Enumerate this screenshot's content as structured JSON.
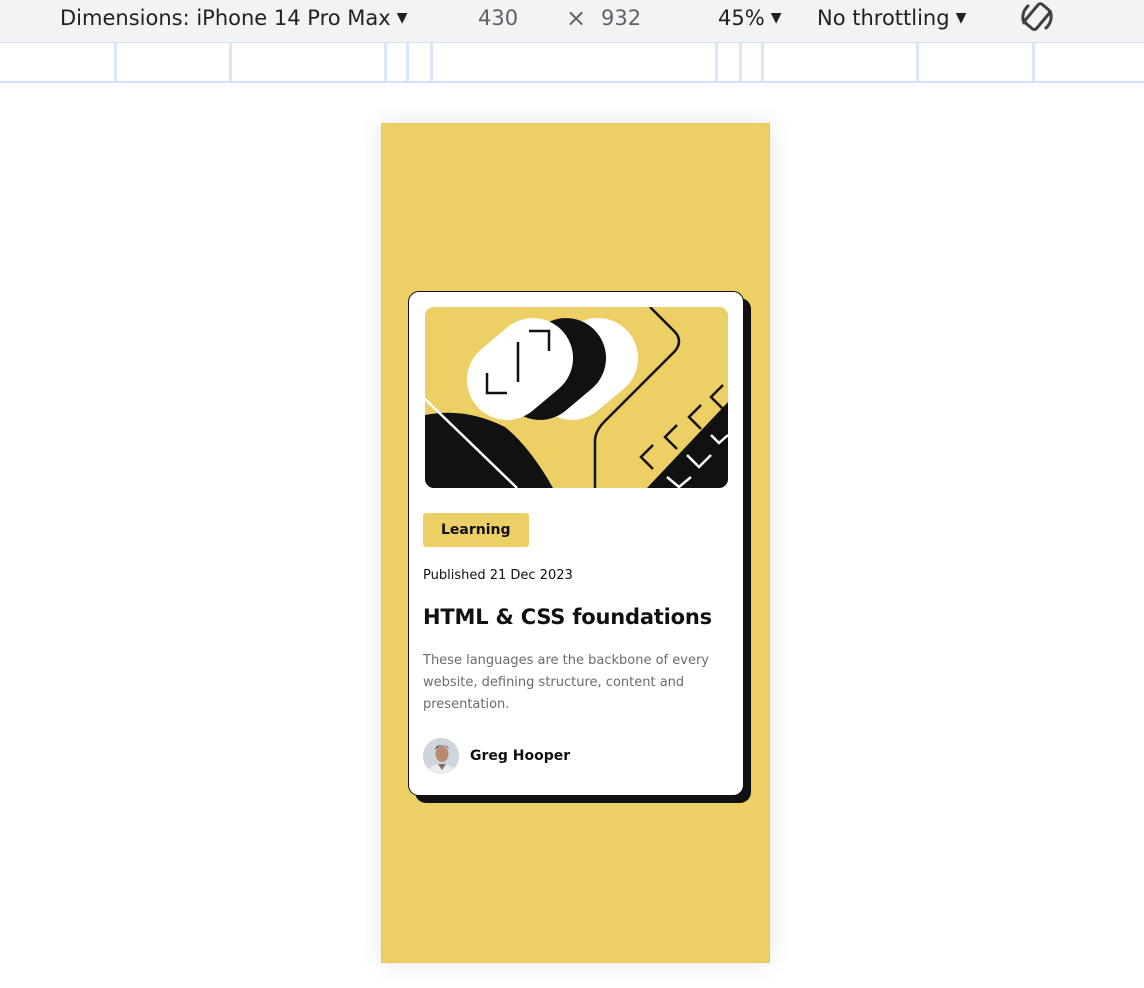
{
  "devtools": {
    "dimensions_label": "Dimensions: iPhone 14 Pro Max",
    "width": "430",
    "times": "×",
    "height": "932",
    "zoom": "45%",
    "throttling": "No throttling",
    "rotate_icon": "rotate-device-icon"
  },
  "card": {
    "tag": "Learning",
    "published": "Published 21 Dec 2023",
    "title": "HTML & CSS foundations",
    "description": "These languages are the backbone of every website, defining structure, content and presentation.",
    "author": "Greg Hooper"
  },
  "colors": {
    "accent": "#ecd065",
    "text": "#111111",
    "muted": "#6b6b6b"
  }
}
